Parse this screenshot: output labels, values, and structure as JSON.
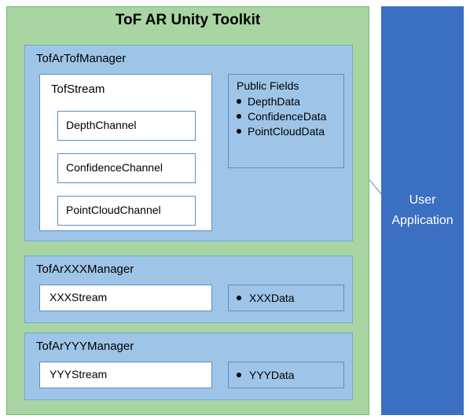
{
  "toolkit": {
    "title": "ToF AR Unity Toolkit"
  },
  "managers": {
    "tof": {
      "name": "TofArTofManager",
      "stream": {
        "name": "TofStream",
        "channels": [
          "DepthChannel",
          "ConfidenceChannel",
          "PointCloudChannel"
        ]
      },
      "publicFields": {
        "title": "Public Fields",
        "items": [
          "DepthData",
          "ConfidenceData",
          "PointCloudData"
        ]
      }
    },
    "xxx": {
      "name": "TofArXXXManager",
      "stream": "XXXStream",
      "data": "XXXData"
    },
    "yyy": {
      "name": "TofArYYYManager",
      "stream": "YYYStream",
      "data": "YYYData"
    }
  },
  "userApp": {
    "line1": "User",
    "line2": "Application"
  }
}
